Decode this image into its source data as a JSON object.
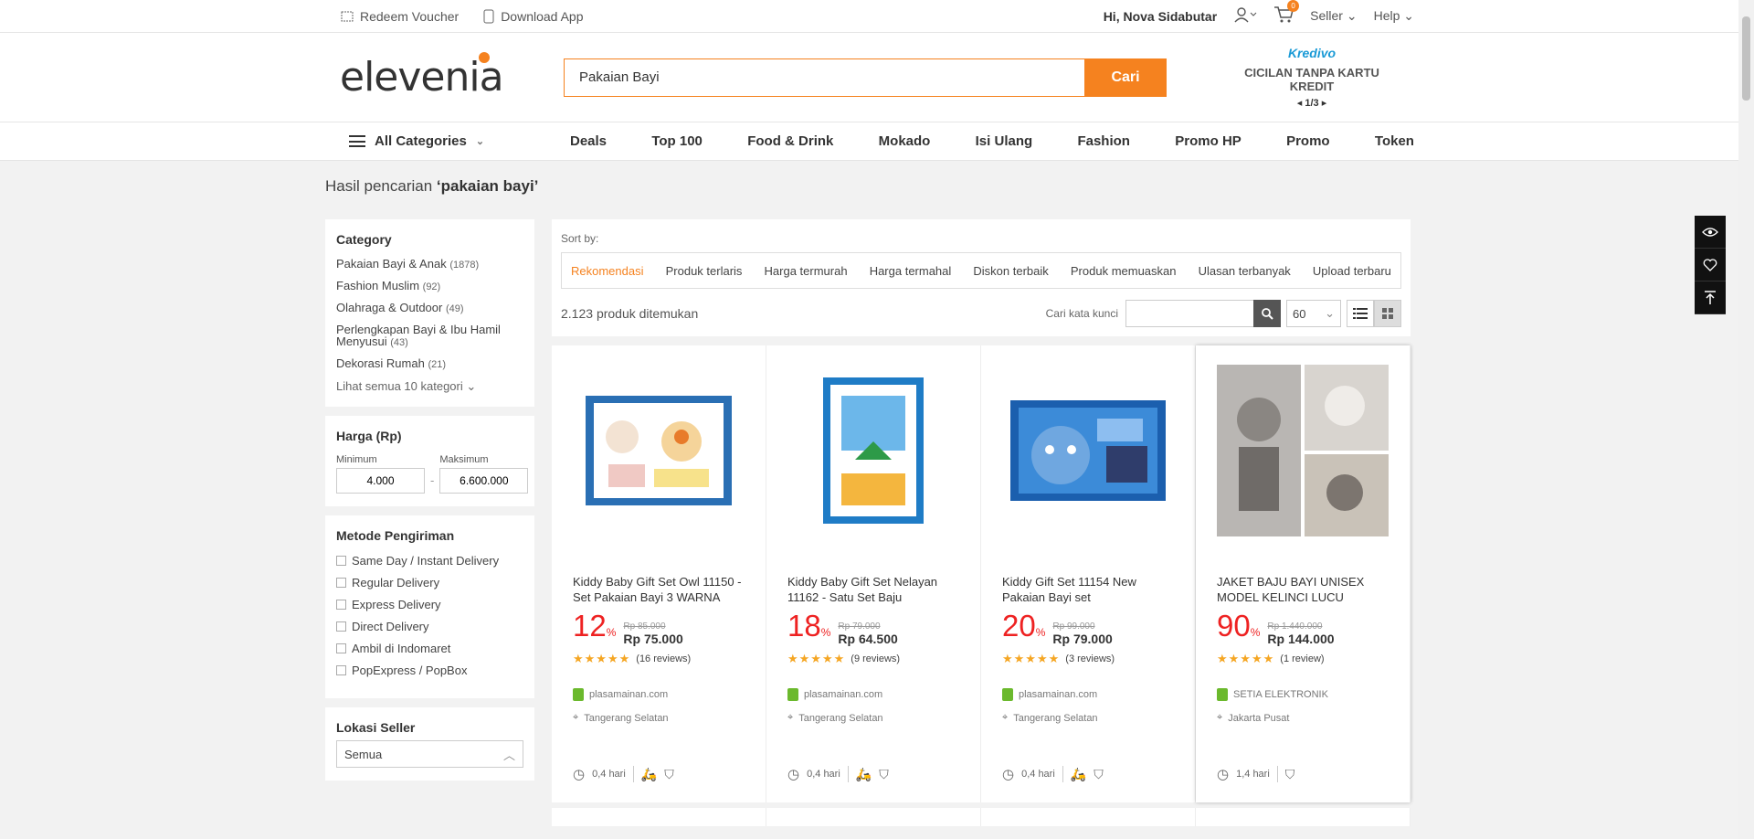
{
  "topbar": {
    "redeem_voucher": "Redeem Voucher",
    "download_app": "Download App",
    "greeting": "Hi, Nova Sidabutar",
    "cart_count": "0",
    "seller": "Seller",
    "help": "Help"
  },
  "header": {
    "logo": "elevenia",
    "search_value": "Pakaian Bayi",
    "search_button": "Cari",
    "kredivo_logo": "Kredivo",
    "kredivo_text": "CICILAN TANPA KARTU KREDIT",
    "kredivo_pager": "1/3"
  },
  "nav": {
    "all_categories": "All Categories",
    "links": [
      "Deals",
      "Top 100",
      "Food & Drink",
      "Mokado",
      "Isi Ulang",
      "Fashion",
      "Promo HP",
      "Promo",
      "Token"
    ]
  },
  "breadcrumb": {
    "prefix": "Hasil pencarian ",
    "query": "‘pakaian bayi’"
  },
  "sidebar": {
    "category_title": "Category",
    "categories": [
      {
        "name": "Pakaian Bayi & Anak",
        "count": "(1878)"
      },
      {
        "name": "Fashion Muslim",
        "count": "(92)"
      },
      {
        "name": "Olahraga & Outdoor",
        "count": "(49)"
      },
      {
        "name": "Perlengkapan Bayi & Ibu Hamil Menyusui",
        "count": "(43)"
      },
      {
        "name": "Dekorasi Rumah",
        "count": "(21)"
      }
    ],
    "see_all": "Lihat semua 10 kategori",
    "price_title": "Harga (Rp)",
    "min_label": "Minimum",
    "max_label": "Maksimum",
    "min_value": "4.000",
    "max_value": "6.600.000",
    "shipping_title": "Metode Pengiriman",
    "shipping": [
      "Same Day / Instant Delivery",
      "Regular Delivery",
      "Express Delivery",
      "Direct Delivery",
      "Ambil di Indomaret",
      "PopExpress / PopBox"
    ],
    "location_title": "Lokasi Seller",
    "location_value": "Semua"
  },
  "sort": {
    "label": "Sort by:",
    "options": [
      "Rekomendasi",
      "Produk terlaris",
      "Harga termurah",
      "Harga termahal",
      "Diskon terbaik",
      "Produk memuaskan",
      "Ulasan terbanyak",
      "Upload terbaru"
    ],
    "result_count": "2.123",
    "result_suffix": "produk ditemukan",
    "keyword_label": "Cari kata kunci",
    "per_page": "60"
  },
  "products": [
    {
      "name": "Kiddy Baby Gift Set Owl 11150 - Set Pakaian Bayi 3 WARNA",
      "discount": "12",
      "old_price": "Rp 85.000",
      "price": "Rp 75.000",
      "stars": "★★★★★",
      "reviews": "(16 reviews)",
      "seller": "plasamainan.com",
      "location": "Tangerang Selatan",
      "ship_time": "0,4 hari"
    },
    {
      "name": "Kiddy Baby Gift Set Nelayan 11162 - Satu Set Baju",
      "discount": "18",
      "old_price": "Rp 79.000",
      "price": "Rp 64.500",
      "stars": "★★★★★",
      "reviews": "(9 reviews)",
      "seller": "plasamainan.com",
      "location": "Tangerang Selatan",
      "ship_time": "0,4 hari"
    },
    {
      "name": "Kiddy Gift Set 11154 New Pakaian Bayi set",
      "discount": "20",
      "old_price": "Rp 99.000",
      "price": "Rp 79.000",
      "stars": "★★★★★",
      "reviews": "(3 reviews)",
      "seller": "plasamainan.com",
      "location": "Tangerang Selatan",
      "ship_time": "0,4 hari"
    },
    {
      "name": "JAKET BAJU BAYI UNISEX MODEL KELINCI LUCU SEKALI",
      "discount": "90",
      "old_price": "Rp 1.440.000",
      "price": "Rp 144.000",
      "stars": "★★★★★",
      "reviews": "(1 review)",
      "seller": "SETIA ELEKTRONIK",
      "location": "Jakarta Pusat",
      "ship_time": "1,4 hari"
    }
  ]
}
